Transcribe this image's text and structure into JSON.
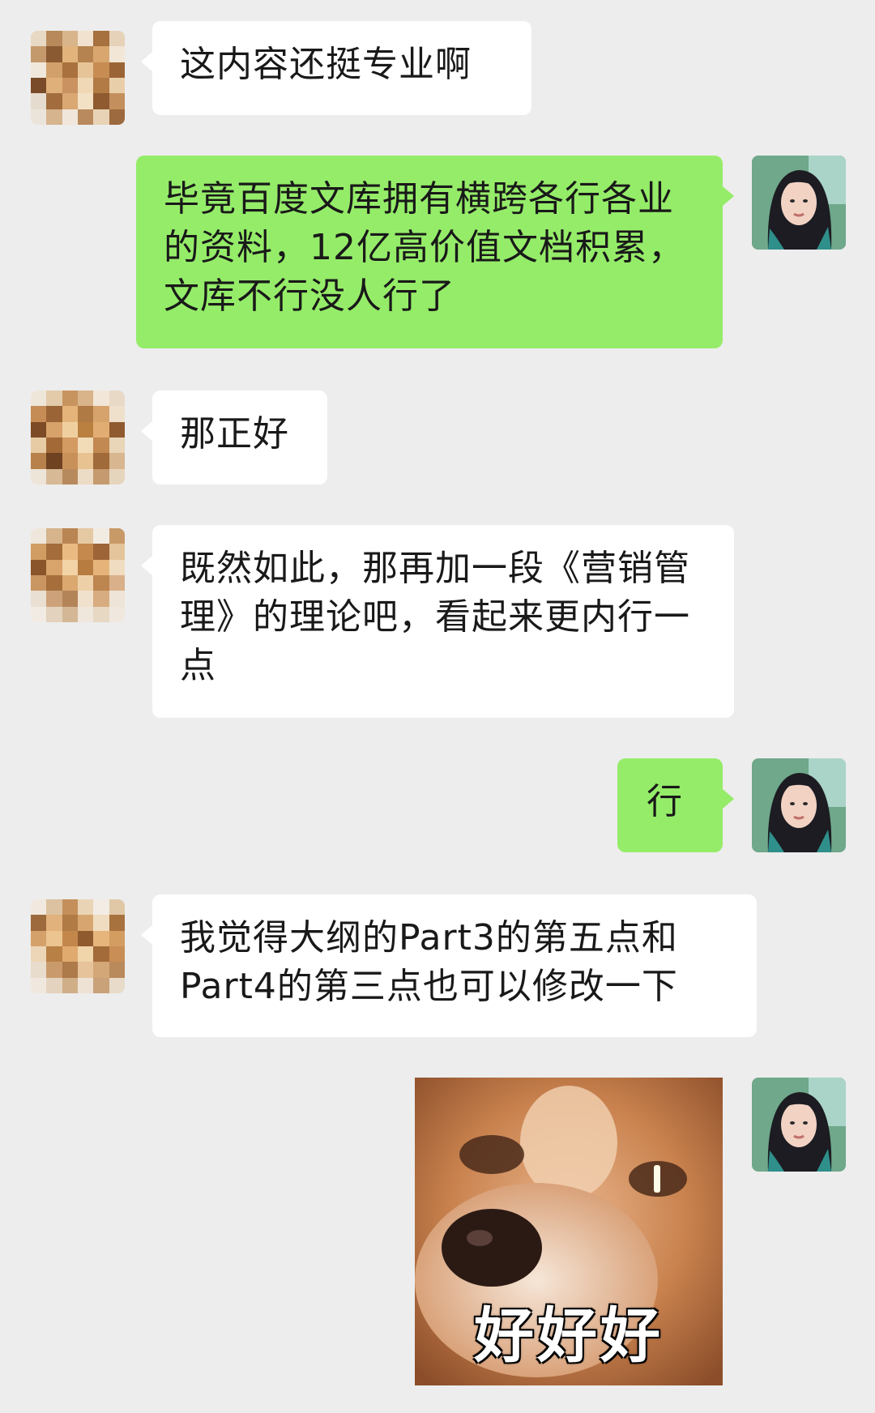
{
  "messages": [
    {
      "side": "in",
      "text": "这内容还挺专业啊"
    },
    {
      "side": "out",
      "text": "毕竟百度文库拥有横跨各行各业的资料，12亿高价值文档积累，文库不行没人行了"
    },
    {
      "side": "in",
      "text": "那正好"
    },
    {
      "side": "in",
      "text": "既然如此，那再加一段《营销管理》的理论吧，看起来更内行一点"
    },
    {
      "side": "out",
      "text": "行"
    },
    {
      "side": "in",
      "text": "我觉得大纲的Part3的第五点和Part4的第三点也可以修改一下"
    },
    {
      "side": "out",
      "type": "sticker",
      "caption": "好好好"
    }
  ],
  "colors": {
    "background": "#ededed",
    "incoming_bubble": "#ffffff",
    "outgoing_bubble": "#95ec69"
  },
  "icons": {
    "contact_avatar": "mosaic-avatar-icon",
    "self_avatar": "user-photo-avatar-icon",
    "sticker": "dog-sticker-image"
  }
}
